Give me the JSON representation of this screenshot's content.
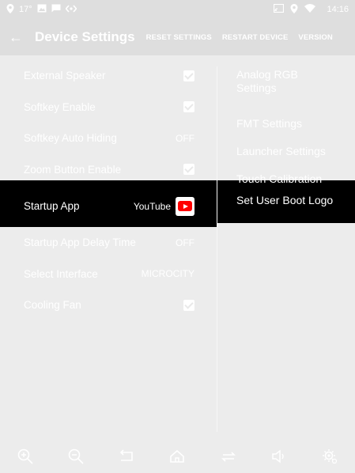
{
  "statusbar": {
    "temperature": "17°",
    "time": "14:16",
    "left_icons": [
      "location-icon",
      "image-icon",
      "message-icon",
      "code-icon"
    ],
    "right_icons": [
      "cast-icon",
      "location-icon",
      "wifi-icon"
    ]
  },
  "appbar": {
    "back_icon": "←",
    "title": "Device Settings",
    "actions": [
      "RESET SETTINGS",
      "RESTART DEVICE",
      "VERSION"
    ]
  },
  "left_settings": [
    {
      "label": "External Speaker",
      "type": "checkbox",
      "checked": true
    },
    {
      "label": "Softkey Enable",
      "type": "checkbox",
      "checked": true
    },
    {
      "label": "Softkey Auto Hiding",
      "type": "text",
      "value": "OFF"
    },
    {
      "label": "Zoom Button Enable",
      "type": "checkbox",
      "checked": true
    },
    {
      "label": "Startup App",
      "type": "app",
      "value": "YouTube",
      "selected": true
    },
    {
      "label": "Startup App Delay Time",
      "type": "text",
      "value": "OFF"
    },
    {
      "label": "Select Interface",
      "type": "text",
      "value": "MICROCITY"
    },
    {
      "label": "Cooling Fan",
      "type": "checkbox",
      "checked": true
    }
  ],
  "right_settings": [
    {
      "label": "Analog RGB Settings"
    },
    {
      "label": "FMT Settings"
    },
    {
      "label": "Launcher Settings"
    },
    {
      "label": "Touch Calibration"
    },
    {
      "label": "Set User Boot Logo",
      "selected": true
    }
  ],
  "navbar": {
    "icons": [
      "zoom-in-icon",
      "zoom-out-icon",
      "back-icon",
      "home-icon",
      "recent-apps-icon",
      "volume-icon",
      "settings-icon"
    ]
  },
  "colors": {
    "background": "#ececec",
    "header": "#dedede",
    "selected_row": "#000000",
    "text": "#ffffff",
    "youtube_red": "#ff0000"
  }
}
